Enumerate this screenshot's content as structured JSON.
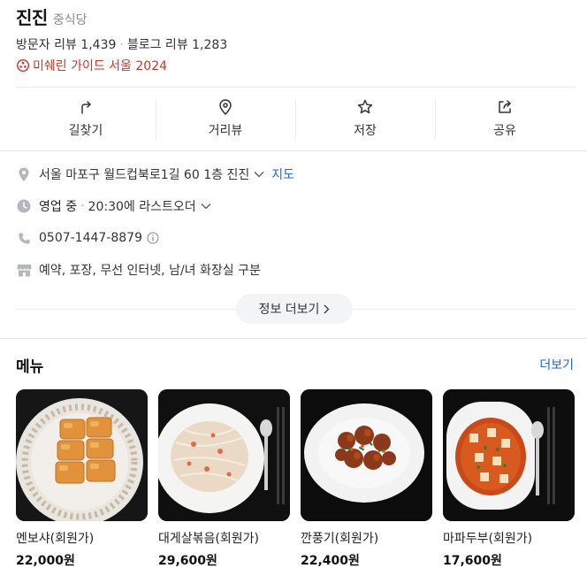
{
  "place": {
    "name": "진진",
    "category": "중식당",
    "visitor_reviews": "방문자 리뷰 1,439",
    "blog_reviews": "블로그 리뷰 1,283",
    "badge": "미쉐린 가이드 서울 2024",
    "badge_icon": "michelin-icon"
  },
  "actions": [
    {
      "label": "길찾기",
      "icon": "directions-icon"
    },
    {
      "label": "거리뷰",
      "icon": "location-pin-icon"
    },
    {
      "label": "저장",
      "icon": "star-icon"
    },
    {
      "label": "공유",
      "icon": "share-icon"
    }
  ],
  "info": {
    "address": "서울 마포구 월드컵북로1길 60 1층 진진",
    "map_link": "지도",
    "status": "영업 중",
    "last_order": "20:30에 라스트오더",
    "phone": "0507-1447-8879",
    "amenities": "예약, 포장, 무선 인터넷, 남/녀 화장실 구분",
    "more_label": "정보 더보기"
  },
  "menu": {
    "title": "메뉴",
    "more_label": "더보기",
    "items": [
      {
        "name": "멘보샤(회원가)",
        "price": "22,000원"
      },
      {
        "name": "대게살볶음(회원가)",
        "price": "29,600원"
      },
      {
        "name": "깐풍기(회원가)",
        "price": "22,400원"
      },
      {
        "name": "마파두부(회원가)",
        "price": "17,600원"
      }
    ]
  },
  "colors": {
    "accent_link": "#2166d4",
    "michelin_red": "#c0392b",
    "divider": "#ececec"
  }
}
